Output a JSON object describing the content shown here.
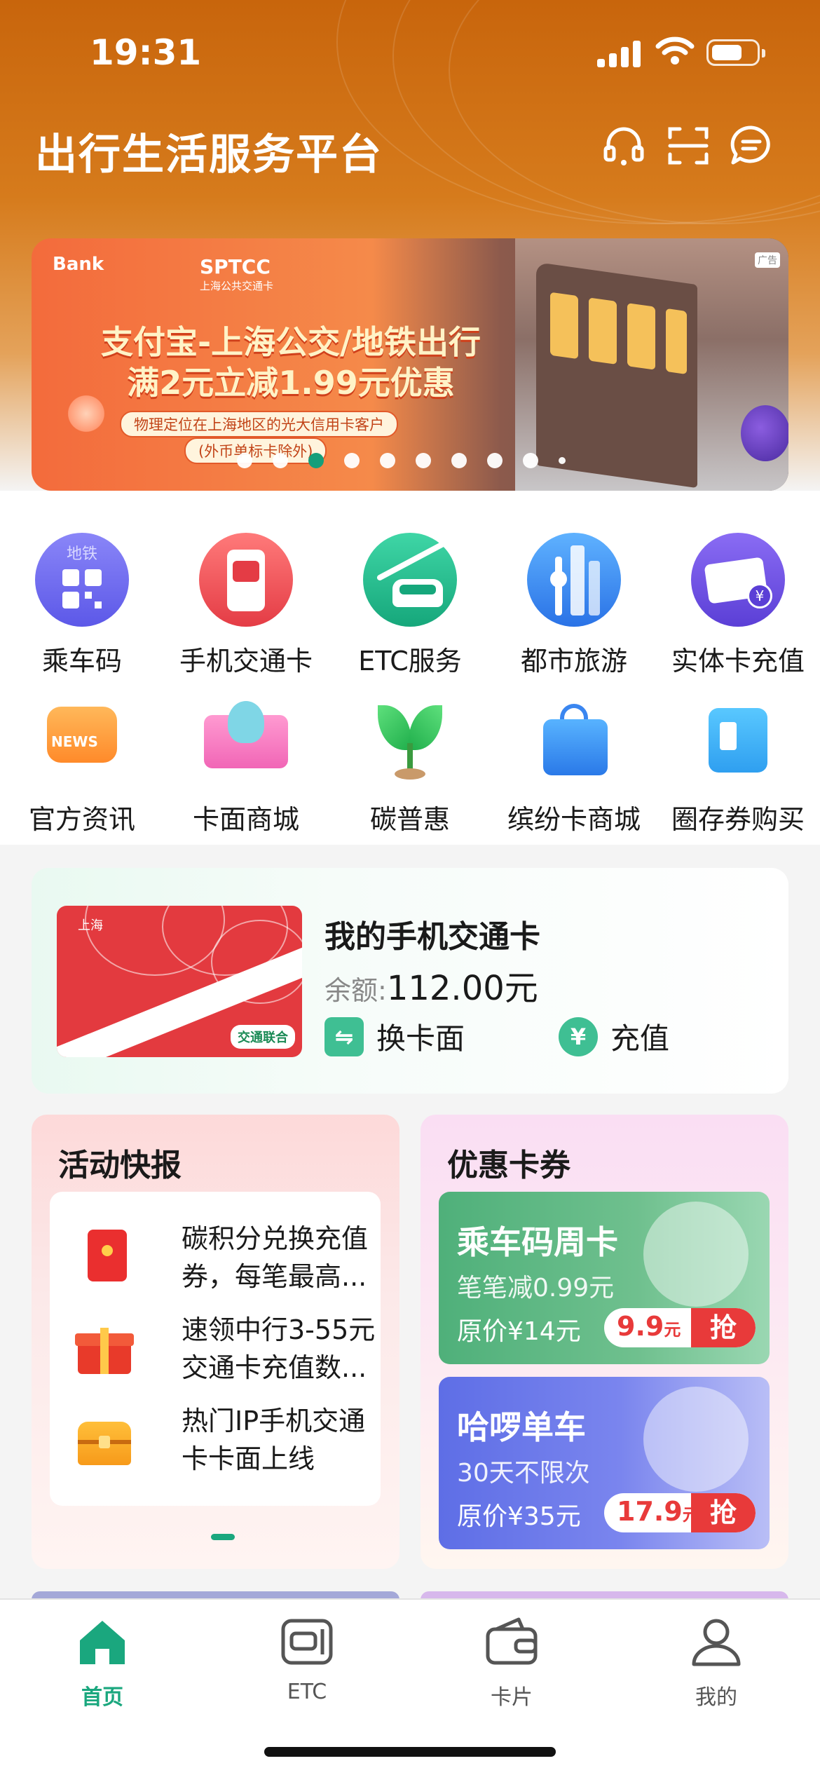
{
  "status": {
    "time": "19:31"
  },
  "header": {
    "title": "出行生活服务平台",
    "icons": [
      "headset-icon",
      "scan-icon",
      "message-icon"
    ]
  },
  "banner": {
    "bank_logo": "Bank",
    "brand": "SPTCC",
    "brand_sub": "上海公共交通卡",
    "line1": "支付宝-上海公交/地铁出行",
    "line2": "满2元立减1.99元优惠",
    "note1": "物理定位在上海地区的光大信用卡客户",
    "note2": "(外币单标卡除外)",
    "ad_tag": "广告",
    "carousel": {
      "total": 10,
      "active_index": 2
    }
  },
  "services": [
    {
      "label": "乘车码",
      "icon": "metro-qr-icon",
      "badge": "地铁"
    },
    {
      "label": "手机交通卡",
      "icon": "phone-card-icon"
    },
    {
      "label": "ETC服务",
      "icon": "etc-car-icon"
    },
    {
      "label": "都市旅游",
      "icon": "city-tour-icon"
    },
    {
      "label": "实体卡充值",
      "icon": "card-recharge-icon"
    },
    {
      "label": "官方资讯",
      "icon": "news-icon",
      "badge": "NEWS"
    },
    {
      "label": "卡面商城",
      "icon": "card-mall-icon"
    },
    {
      "label": "碳普惠",
      "icon": "sprout-icon"
    },
    {
      "label": "缤纷卡商城",
      "icon": "shopping-bag-icon"
    },
    {
      "label": "圈存券购买",
      "icon": "voucher-icon"
    }
  ],
  "my_card": {
    "title": "我的手机交通卡",
    "balance_label": "余额:",
    "balance_value": "112.00元",
    "card_city": "上海",
    "card_badge": "交通联合",
    "actions": [
      {
        "label": "换卡面",
        "icon": "swap-icon"
      },
      {
        "label": "充值",
        "icon": "yen-icon"
      }
    ]
  },
  "activity": {
    "title": "活动快报",
    "items": [
      {
        "text": "碳积分兑换充值券，每笔最高...",
        "icon": "red-envelope-icon"
      },
      {
        "text": "速领中行3-55元交通卡充值数...",
        "icon": "gift-box-icon"
      },
      {
        "text": "热门IP手机交通卡卡面上线",
        "icon": "treasure-chest-icon"
      }
    ]
  },
  "coupons": {
    "title": "优惠卡券",
    "items": [
      {
        "title": "乘车码周卡",
        "subtitle": "笔笔减0.99元",
        "original": "原价¥14元",
        "price": "9.9",
        "unit": "元",
        "action": "抢",
        "art": "conductor-avatar-icon"
      },
      {
        "title": "哈啰单车",
        "subtitle": "30天不限次",
        "original": "原价¥35元",
        "price": "17.9",
        "unit": "元",
        "action": "抢",
        "art": "bike-mascot-icon"
      }
    ]
  },
  "tabbar": [
    {
      "label": "首页",
      "icon": "home-icon",
      "active": true
    },
    {
      "label": "ETC",
      "icon": "etc-icon",
      "active": false
    },
    {
      "label": "卡片",
      "icon": "wallet-icon",
      "active": false
    },
    {
      "label": "我的",
      "icon": "profile-icon",
      "active": false
    }
  ],
  "colors": {
    "accent": "#1aa77e",
    "header": "#c8650c",
    "price_red": "#e83a3a"
  }
}
